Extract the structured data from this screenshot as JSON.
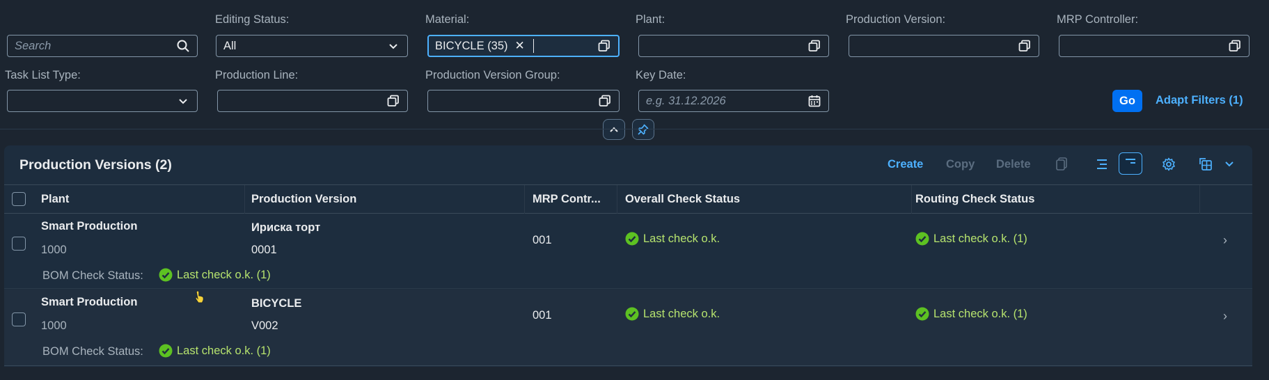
{
  "filters": {
    "search": {
      "placeholder": "Search"
    },
    "editing_status": {
      "label": "Editing Status:",
      "value": "All"
    },
    "material": {
      "label": "Material:",
      "token": "BICYCLE (35)"
    },
    "plant": {
      "label": "Plant:",
      "value": ""
    },
    "production_version": {
      "label": "Production Version:",
      "value": ""
    },
    "mrp_controller": {
      "label": "MRP Controller:",
      "value": ""
    },
    "task_list_type": {
      "label": "Task List Type:",
      "value": ""
    },
    "production_line": {
      "label": "Production Line:",
      "value": ""
    },
    "production_version_group": {
      "label": "Production Version Group:",
      "value": ""
    },
    "key_date": {
      "label": "Key Date:",
      "placeholder": "e.g. 31.12.2026"
    },
    "go_label": "Go",
    "adapt_label": "Adapt Filters (1)"
  },
  "table": {
    "title": "Production Versions (2)",
    "toolbar": {
      "create": "Create",
      "copy": "Copy",
      "delete": "Delete"
    },
    "columns": [
      "Plant",
      "Production Version",
      "MRP Contr...",
      "Overall Check Status",
      "Routing Check Status"
    ],
    "rows": [
      {
        "plant_name": "Smart Production",
        "plant_id": "1000",
        "pv_name": "Ириска торт",
        "pv_id": "0001",
        "mrp": "001",
        "overall": "Last check o.k.",
        "routing": "Last check o.k. (1)",
        "bom_label": "BOM Check Status:",
        "bom": "Last check o.k. (1)"
      },
      {
        "plant_name": "Smart Production",
        "plant_id": "1000",
        "pv_name": "BICYCLE",
        "pv_id": "V002",
        "mrp": "001",
        "overall": "Last check o.k.",
        "routing": "Last check o.k. (1)",
        "bom_label": "BOM Check Status:",
        "bom": "Last check o.k. (1)"
      }
    ]
  },
  "colors": {
    "accent": "#4db1ff",
    "go": "#0070f2",
    "positive": "#b6e36e",
    "check": "#5dc122"
  }
}
